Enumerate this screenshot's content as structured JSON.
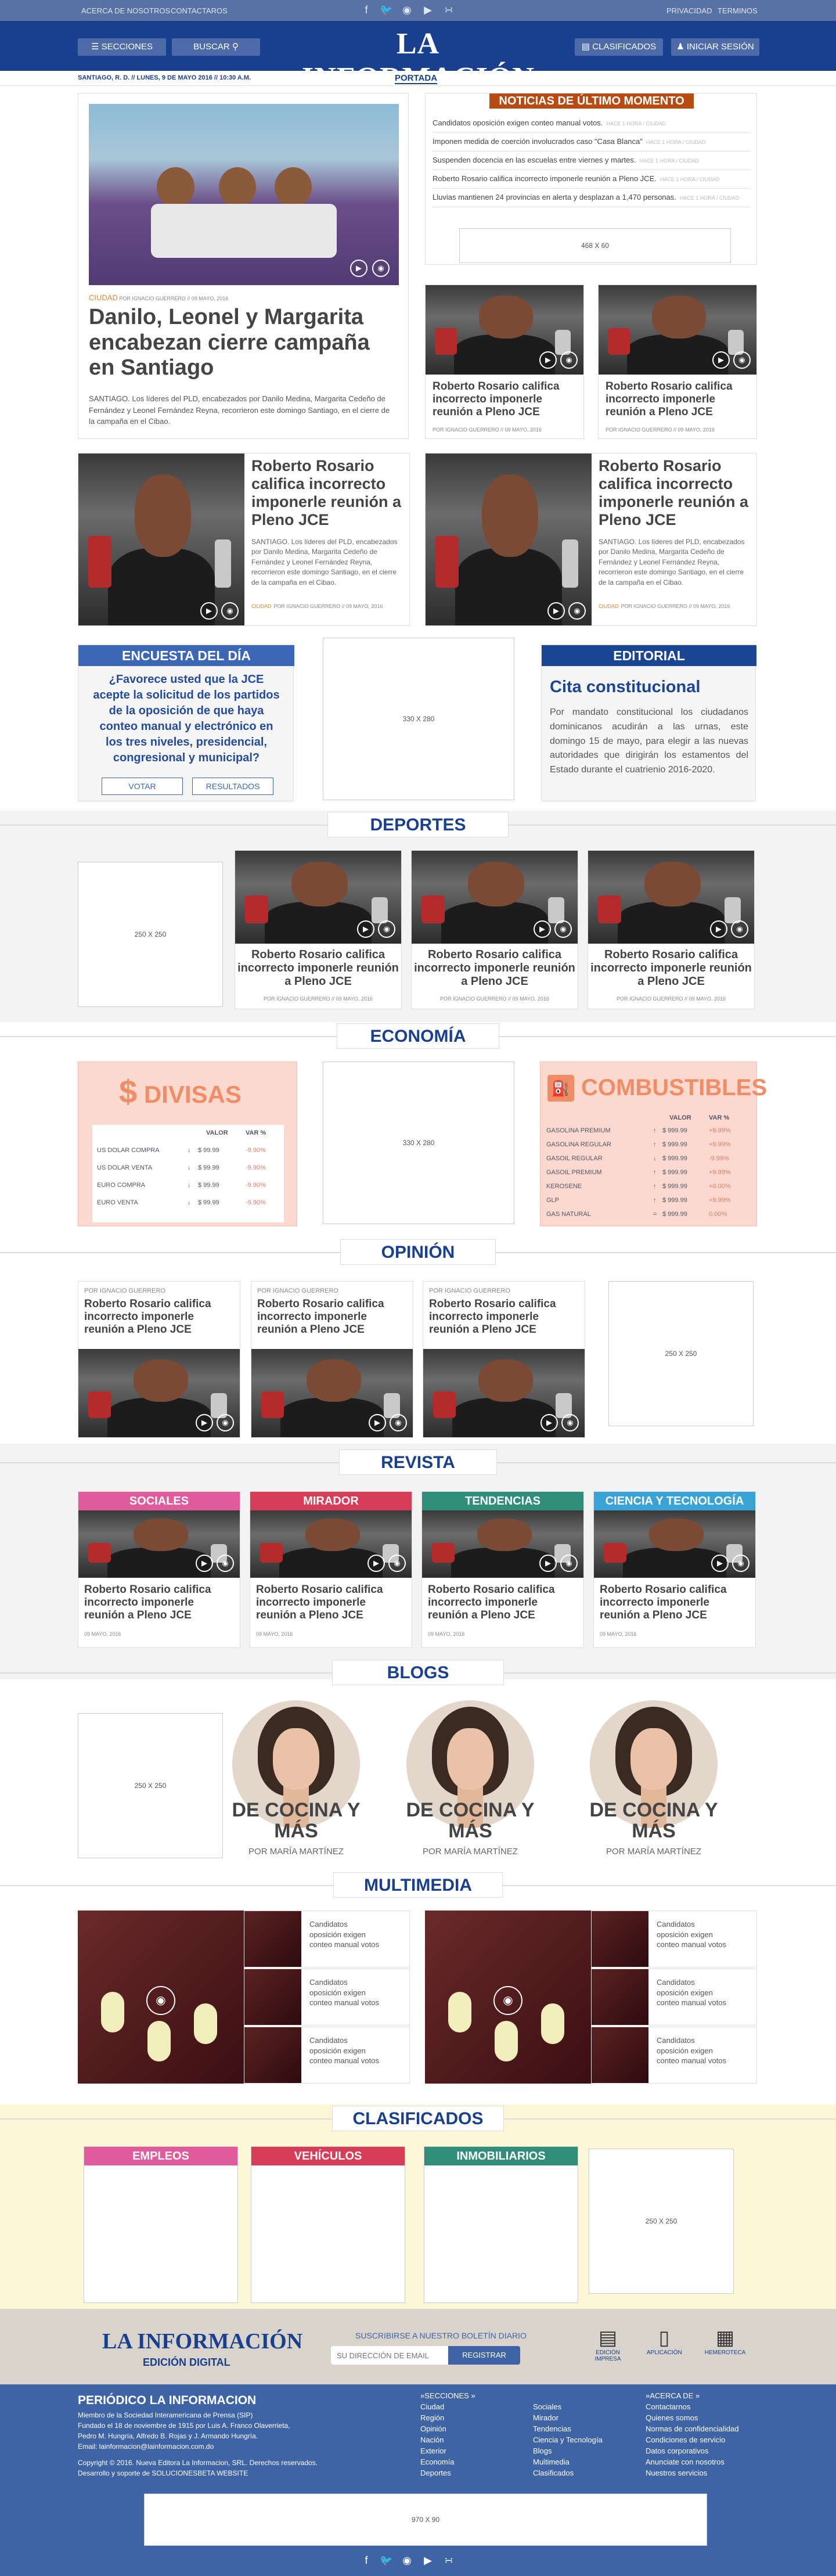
{
  "topbar": {
    "links": [
      "ACERCA DE NOSOTROS",
      "CONTACTAROS"
    ],
    "right_links": [
      "PRIVACIDAD",
      "TERMINOS"
    ],
    "social": [
      "facebook-icon",
      "twitter-icon",
      "instagram-icon",
      "youtube-icon",
      "rss-icon"
    ]
  },
  "header": {
    "sections_label": "SECCIONES",
    "search_label": "BUSCAR",
    "logo": "LA INFORMACIÓN",
    "classifieds_label": "CLASIFICADOS",
    "login_label": "INICIAR SESIÓN"
  },
  "datebar": {
    "date": "SANTIAGO, R. D. // LUNES, 9 DE MAYO 2016 // 10:30 A.M.",
    "section": "PORTADA"
  },
  "main_story": {
    "kicker": "CIUDAD",
    "byline": "POR IGNACIO GUERRERO // 09 MAYO, 2016",
    "title": "Danilo, Leonel y Margarita encabezan cierre campaña en Santiago",
    "summary": "SANTIAGO. Los líderes del PLD, encabezados por Danilo Medina, Margarita Cedeño de Fernández y Leonel Fernández Reyna, recorrieron este domingo Santiago, en el cierre de la campaña en el Cibao."
  },
  "breaking": {
    "title": "NOTICIAS DE ÚLTIMO MOMENTO",
    "items": [
      {
        "text": "Candidatos oposición exigen conteo manual votos.",
        "time": "HACE 1 HORA / CIUDAD"
      },
      {
        "text": "Imponen medida de coerción involucrados caso \"Casa Blanca\"",
        "time": "HACE 1 HORA / CIUDAD"
      },
      {
        "text": "Suspenden docencia en las escuelas entre viernes y martes.",
        "time": "HACE 1 HORA / CIUDAD"
      },
      {
        "text": "Roberto Rosario califica incorrecto imponerle reunión a Pleno JCE.",
        "time": "HACE 1 HORA / CIUDAD"
      },
      {
        "text": "Lluvias mantienen 24 provincias en alerta y desplazan a 1,470 personas.",
        "time": "HACE 1 HORA / CIUDAD"
      }
    ],
    "ad": "468 X 60"
  },
  "small_stories": [
    {
      "title": "Roberto Rosario califica incorrecto imponerle reunión a Pleno JCE",
      "byline": "POR IGNACIO GUERRERO // 09 MAYO, 2016"
    },
    {
      "title": "Roberto Rosario califica incorrecto imponerle reunión a Pleno JCE",
      "byline": "POR IGNACIO GUERRERO // 09 MAYO, 2016"
    }
  ],
  "medium_stories": [
    {
      "title": "Roberto Rosario califica incorrecto imponerle reunión a Pleno JCE",
      "summary": "SANTIAGO. Los líderes del PLD, encabezados por Danilo Medina, Margarita Cedeño de Fernández y Leonel Fernández Reyna, recorrieron este domingo Santiago, en el cierre de la campaña en el Cibao.",
      "kicker": "CIUDAD",
      "byline": "POR IGNACIO GUERRERO // 09 MAYO, 2016"
    },
    {
      "title": "Roberto Rosario califica incorrecto imponerle reunión a Pleno JCE",
      "summary": "SANTIAGO. Los líderes del PLD, encabezados por Danilo Medina, Margarita Cedeño de Fernández y Leonel Fernández Reyna, recorrieron este domingo Santiago, en el cierre de la campaña en el Cibao.",
      "kicker": "CIUDAD",
      "byline": "POR IGNACIO GUERRERO // 09 MAYO, 2016"
    }
  ],
  "poll": {
    "title": "ENCUESTA DEL DÍA",
    "question": "¿Favorece usted que la JCE acepte la solicitud de los partidos de la oposición de que haya conteo manual y electrónico en los tres niveles, presidencial, congresional y municipal?",
    "vote": "VOTAR",
    "results": "RESULTADOS"
  },
  "ad_330": "330 X 280",
  "editorial": {
    "title": "EDITORIAL",
    "headline": "Cita constitucional",
    "text": "Por mandato constitucional los ciudadanos dominicanos acudirán a las urnas, este domingo 15 de mayo, para elegir a las nuevas autoridades que dirigirán los estamentos del Estado durante el cuatrienio 2016-2020."
  },
  "sections": {
    "deportes": "DEPORTES",
    "economia": "ECONOMÍA",
    "opinion": "OPINIÓN",
    "revista": "REVISTA",
    "blogs": "BLOGS",
    "multimedia": "MULTIMEDIA",
    "clasificados": "CLASIFICADOS"
  },
  "ad_250": "250 X 250",
  "deportes_story": {
    "title": "Roberto Rosario califica incorrecto imponerle reunión a Pleno JCE",
    "byline": "POR IGNACIO GUERRERO // 09 MAYO, 2016"
  },
  "divisas": {
    "title": "DIVISAS",
    "cols": [
      "VALOR",
      "VAR %"
    ],
    "rows": [
      {
        "name": "US DOLAR COMPRA",
        "value": "$ 99.99",
        "var": "-9.90%"
      },
      {
        "name": "US DOLAR VENTA",
        "value": "$ 99.99",
        "var": "-9.90%"
      },
      {
        "name": "EURO COMPRA",
        "value": "$ 99.99",
        "var": "-9.90%"
      },
      {
        "name": "EURO VENTA",
        "value": "$ 99.99",
        "var": "-9.90%"
      }
    ]
  },
  "combustibles": {
    "title": "COMBUSTIBLES",
    "cols": [
      "VALOR",
      "VAR %"
    ],
    "rows": [
      {
        "name": "GASOLINA PREMIUM",
        "value": "$ 999.99",
        "var": "+9.99%"
      },
      {
        "name": "GASOLINA REGULAR",
        "value": "$ 999.99",
        "var": "+9.99%"
      },
      {
        "name": "GASOIL REGULAR",
        "value": "$ 999.99",
        "var": "-9.99%"
      },
      {
        "name": "GASOIL PREMIUM",
        "value": "$ 999.99",
        "var": "+9.99%"
      },
      {
        "name": "KEROSENE",
        "value": "$ 999.99",
        "var": "+0.00%"
      },
      {
        "name": "GLP",
        "value": "$ 999.99",
        "var": "+9.99%"
      },
      {
        "name": "GAS NATURAL",
        "value": "$ 999.99",
        "var": "0.00%"
      }
    ]
  },
  "opinion_story": {
    "byline": "POR IGNACIO GUERRERO",
    "title": "Roberto Rosario califica incorrecto imponerle reunión a Pleno JCE"
  },
  "revista": [
    {
      "cat": "SOCIALES",
      "color": "#e05a9c"
    },
    {
      "cat": "MIRADOR",
      "color": "#d93c56"
    },
    {
      "cat": "TENDENCIAS",
      "color": "#2f8d7a"
    },
    {
      "cat": "CIENCIA Y TECNOLOGÍA",
      "color": "#3aa3d6"
    }
  ],
  "revista_story": {
    "title": "Roberto Rosario califica incorrecto imponerle reunión a Pleno JCE",
    "date": "09 MAYO, 2016"
  },
  "blogs": [
    {
      "title": "DE COCINA Y MÁS",
      "by": "POR MARÍA MARTÍNEZ"
    },
    {
      "title": "DE COCINA Y MÁS",
      "by": "POR MARÍA MARTÍNEZ"
    },
    {
      "title": "DE COCINA Y MÁS",
      "by": "POR MARÍA MARTÍNEZ"
    }
  ],
  "multimedia_item": "Candidatos oposición exigen conteo manual votos",
  "clasificados": [
    {
      "cat": "EMPLEOS",
      "color": "#e05a9c"
    },
    {
      "cat": "VEHÍCULOS",
      "color": "#d93c56"
    },
    {
      "cat": "INMOBILIARIOS",
      "color": "#2f8d7a"
    }
  ],
  "footer": {
    "logo": "LA INFORMACIÓN",
    "edition": "EDICIÓN DIGITAL",
    "subscribe_label": "SUSCRIBIRSE A NUESTRO BOLETÍN DIARIO",
    "email_placeholder": "SU DIRECCIÓN DE EMAIL",
    "register": "REGISTRAR",
    "apps": [
      "EDICIÓN IMPRESA",
      "APLICACIÓN",
      "HEMEROTECA"
    ],
    "about_title": "PERIÓDICO LA INFORMACION",
    "about_lines": [
      "Miembro de la Sociedad Interamericana de Prensa (SIP)",
      "Fundado el 18 de noviembre de 1915 por Luis A. Franco Olaverrieta,",
      "Pedro M. Hungría, Alfredo B. Rojas y J. Armando Hungría.",
      "Email: lainformacion@lainformacion.com.do"
    ],
    "copyright": "Copyright © 2016. Nueva Editora La Informacion, SRL. Derechos reservados.",
    "dev": "Desarrollo y soporte de SOLUCIONESBETA WEBSITE",
    "col1_title": "»SECCIONES »",
    "col1": [
      "Ciudad",
      "Región",
      "Opinión",
      "Nación",
      "Exterior",
      "Economía",
      "Deportes"
    ],
    "col2": [
      "Sociales",
      "Mirador",
      "Tendencias",
      "Ciencia y Tecnología",
      "Blogs",
      "Multimedia",
      "Clasificados"
    ],
    "col3_title": "»ACERCA DE »",
    "col3": [
      "Contactarnos",
      "Quienes somos",
      "Normas de confidencialidad",
      "Condiciones de servicio",
      "Datos corporativos",
      "Anunciate con nosotros",
      "Nuestros servicios"
    ],
    "ad": "970 X 90"
  }
}
